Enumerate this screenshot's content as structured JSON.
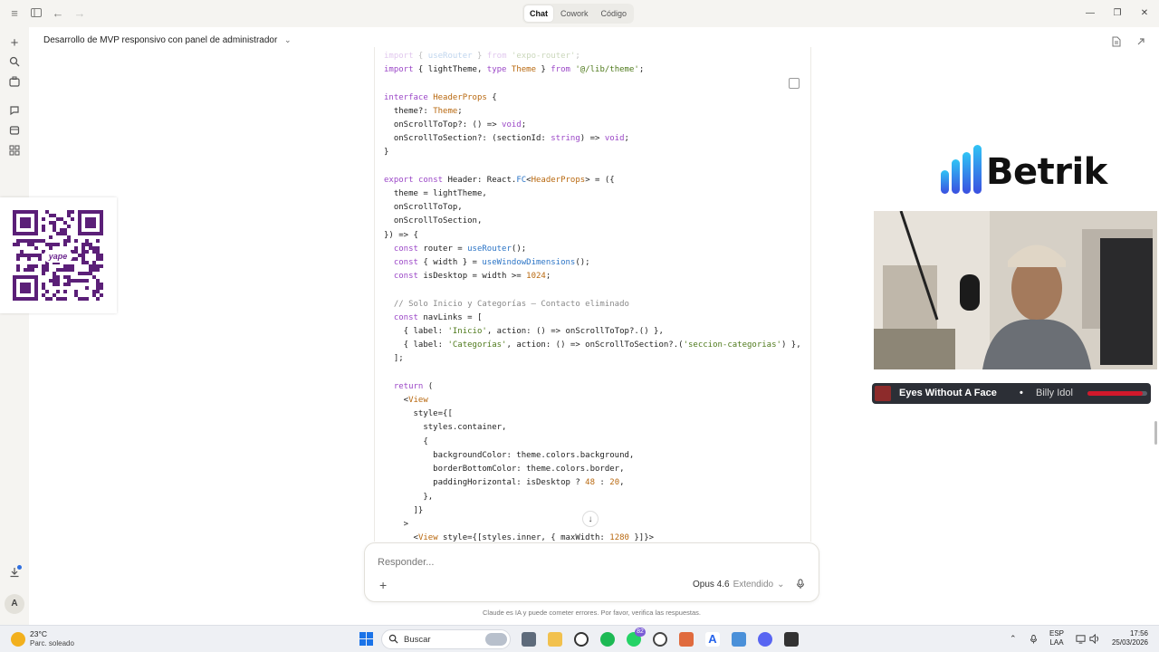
{
  "titlebar": {
    "modes": [
      "Chat",
      "Cowork",
      "Código"
    ],
    "active_mode": "Chat",
    "icons": [
      "menu-icon",
      "sidebar-toggle-icon",
      "back-arrow-icon",
      "forward-arrow-icon"
    ]
  },
  "rail": {
    "icons": [
      "new-chat-icon",
      "search-icon",
      "projects-icon",
      "chats-icon",
      "artifacts-icon",
      "code-icon",
      "download-icon"
    ],
    "avatar_initial": "A"
  },
  "header": {
    "conversation_title": "Desarrollo de MVP responsivo con panel de administrador"
  },
  "code": {
    "lines": [
      "import { useRouter } from 'expo-router';",
      "import { lightTheme, type Theme } from '@/lib/theme';",
      "",
      "interface HeaderProps {",
      "  theme?: Theme;",
      "  onScrollToTop?: () => void;",
      "  onScrollToSection?: (sectionId: string) => void;",
      "}",
      "",
      "export const Header: React.FC<HeaderProps> = ({",
      "  theme = lightTheme,",
      "  onScrollToTop,",
      "  onScrollToSection,",
      "}) => {",
      "  const router = useRouter();",
      "  const { width } = useWindowDimensions();",
      "  const isDesktop = width >= 1024;",
      "",
      "  // Solo Inicio y Categorías — Contacto eliminado",
      "  const navLinks = [",
      "    { label: 'Inicio', action: () => onScrollToTop?.() },",
      "    { label: 'Categorías', action: () => onScrollToSection?.('seccion-categorias') },",
      "  ];",
      "",
      "  return (",
      "    <View",
      "      style={[",
      "        styles.container,",
      "        {",
      "          backgroundColor: theme.colors.background,",
      "          borderBottomColor: theme.colors.border,",
      "          paddingHorizontal: isDesktop ? 48 : 20,",
      "        },",
      "      ]}",
      "    >",
      "      <View style={[styles.inner, { maxWidth: 1280 }]}>"
    ]
  },
  "composer": {
    "placeholder": "Responder...",
    "model": "Opus 4.6",
    "mode": "Extendido",
    "disclaimer": "Claude es IA y puede cometer errores. Por favor, verifica las respuestas."
  },
  "overlay": {
    "qr_label": "yape",
    "brand": "Betrik",
    "now_playing": {
      "title": "Eyes Without A Face",
      "separator": "•",
      "artist": "Billy Idol",
      "progress": 0.92
    }
  },
  "taskbar": {
    "temperature": "23°C",
    "weather": "Parc. soleado",
    "search_label": "Buscar",
    "lang_line1": "ESP",
    "lang_line2": "LAA",
    "time": "17:56",
    "date": "25/03/2026",
    "badge_count": "82"
  },
  "colors": {
    "accent_keyword": "#9b47c7",
    "accent_string": "#4f7a1c",
    "accent_function": "#2b74c6",
    "brand_blue": "#1a73e8",
    "spotify_red": "#d1182b"
  }
}
